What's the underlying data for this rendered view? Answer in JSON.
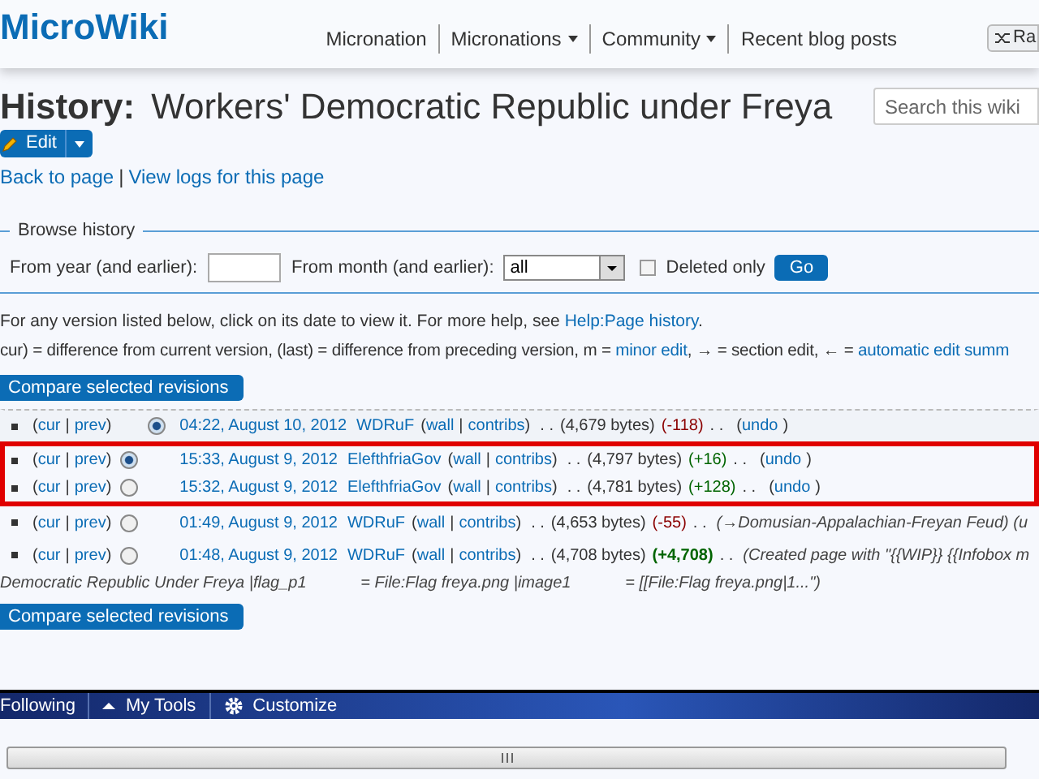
{
  "header": {
    "logo": "MicroWiki",
    "nav": [
      {
        "label": "Micronation",
        "dropdown": false
      },
      {
        "label": "Micronations",
        "dropdown": true
      },
      {
        "label": "Community",
        "dropdown": true
      },
      {
        "label": "Recent blog posts",
        "dropdown": false
      }
    ],
    "random_button": "Ra"
  },
  "title": {
    "prefix": "History:",
    "name": "Workers' Democratic Republic under Freya"
  },
  "search": {
    "placeholder": "Search this wiki"
  },
  "edit_button": "Edit",
  "page_links": [
    "Back to page",
    "|",
    "View logs for this page"
  ],
  "browse": {
    "legend": "Browse history",
    "year_label": "From year (and earlier):",
    "month_label": "From month (and earlier):",
    "month_value": "all",
    "deleted_label": "Deleted only",
    "deleted_checked": false,
    "go": "Go"
  },
  "help_line": {
    "text": "For any version listed below, click on its date to view it. For more help, see ",
    "link": "Help:Page history",
    "end": "."
  },
  "legend_line": {
    "parts": [
      {
        "kind": "text",
        "text": "cur) = difference from current version, (last) = difference from preceding version, m = "
      },
      {
        "kind": "link",
        "text": "minor edit"
      },
      {
        "kind": "text",
        "text": ", → = section edit, ← = "
      },
      {
        "kind": "link",
        "text": "automatic edit summ"
      }
    ]
  },
  "compare_button": "Compare selected revisions",
  "revisions": [
    {
      "kind": "latest",
      "diff": [
        "(",
        "cur",
        "|",
        "prev",
        ")"
      ],
      "selected": true,
      "date": "04:22, August 10, 2012",
      "user": "WDRuF",
      "user_links": [
        "(",
        "wall",
        "|",
        "contribs",
        ")"
      ],
      "dots": ". .",
      "size": "(4,679 bytes)",
      "change": "(-118)",
      "color": "#8b0000",
      "bold": false,
      "dots_after": ". .",
      "undo": [
        "(",
        "undo",
        ")"
      ],
      "highlighted": false
    },
    {
      "kind": "older",
      "diff": [
        "(",
        "cur",
        "|",
        "prev",
        ")"
      ],
      "selected": true,
      "date": "15:33, August 9, 2012",
      "user": "ElefthfriaGov",
      "user_links": [
        "(",
        "wall",
        "|",
        "contribs",
        ")"
      ],
      "dots": ". .",
      "size": "(4,797 bytes)",
      "change": "(+16)",
      "color": "#006400",
      "bold": false,
      "dots_after": ". .",
      "undo": [
        "(",
        "undo",
        ")"
      ],
      "highlighted": true
    },
    {
      "kind": "older",
      "diff": [
        "(",
        "cur",
        "|",
        "prev",
        ")"
      ],
      "selected": false,
      "date": "15:32, August 9, 2012",
      "user": "ElefthfriaGov",
      "user_links": [
        "(",
        "wall",
        "|",
        "contribs",
        ")"
      ],
      "dots": ". .",
      "size": "(4,781 bytes)",
      "change": "(+128)",
      "color": "#006400",
      "bold": false,
      "dots_after": ". .",
      "undo": [
        "(",
        "undo",
        ")"
      ],
      "highlighted": true
    },
    {
      "kind": "older",
      "diff": [
        "(",
        "cur",
        "|",
        "prev",
        ")"
      ],
      "selected": false,
      "date": "01:49, August 9, 2012",
      "user": "WDRuF",
      "user_links": [
        "(",
        "wall",
        "|",
        "contribs",
        ")"
      ],
      "dots": ". .",
      "size": "(4,653 bytes)",
      "change": "(-55)",
      "color": "#8b0000",
      "bold": false,
      "dots_after": ". .",
      "summary": "(→Domusian-Appalachian-Freyan Feud) (u",
      "highlighted": false
    },
    {
      "kind": "older",
      "diff": [
        "(",
        "cur",
        "|",
        "prev",
        ")"
      ],
      "selected": false,
      "date": "01:48, August 9, 2012",
      "user": "WDRuF",
      "user_links": [
        "(",
        "wall",
        "|",
        "contribs",
        ")"
      ],
      "dots": ". .",
      "size": "(4,708 bytes)",
      "change": "(+4,708)",
      "color": "#006400",
      "bold": true,
      "dots_after": ". .",
      "summary": "(Created page with \"{{WIP}} {{Infobox m",
      "summary_more": "Democratic Republic Under Freya |flag_p1            = File:Flag freya.png |image1            = [[File:Flag freya.png|1...\")",
      "highlighted": false
    }
  ],
  "compare_button_bottom": "Compare selected revisions",
  "toolbar": {
    "items": [
      "Following",
      "My Tools",
      "Customize"
    ]
  }
}
